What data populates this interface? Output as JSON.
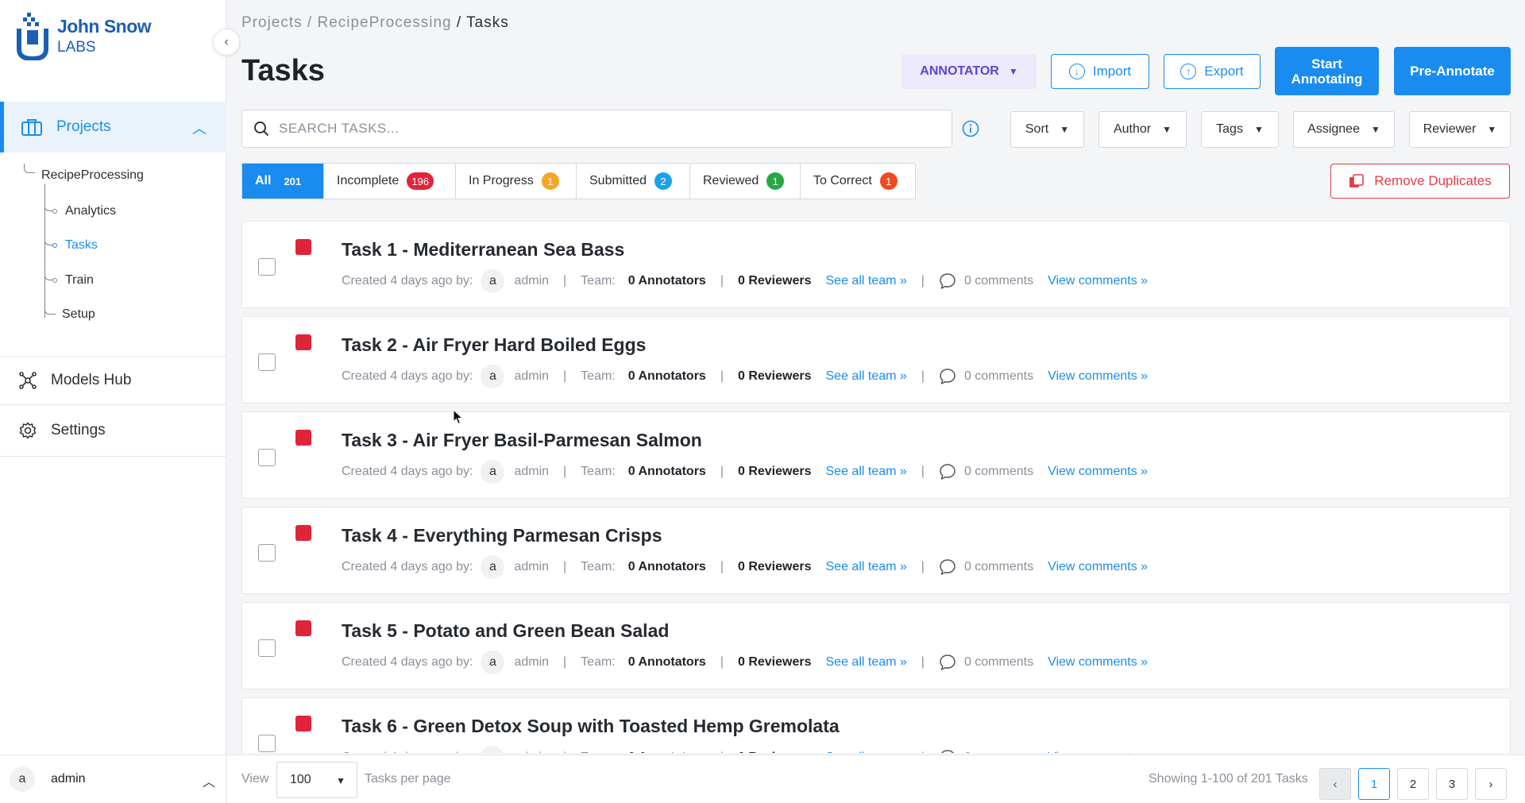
{
  "app": {
    "logo_line1": "John Snow",
    "logo_line2": "LABS"
  },
  "sidebar": {
    "projects_label": "Projects",
    "project_name": "RecipeProcessing",
    "sub_items": [
      {
        "label": "Analytics"
      },
      {
        "label": "Tasks"
      },
      {
        "label": "Train"
      },
      {
        "label": "Setup"
      }
    ],
    "models_hub_label": "Models Hub",
    "settings_label": "Settings",
    "user_initial": "a",
    "user_name": "admin"
  },
  "breadcrumb": {
    "part1": "Projects",
    "part2": "RecipeProcessing",
    "current": "Tasks"
  },
  "page_title": "Tasks",
  "toolbar": {
    "role": "ANNOTATOR",
    "import_label": "Import",
    "export_label": "Export",
    "start_line1": "Start",
    "start_line2": "Annotating",
    "preannotate_label": "Pre-Annotate"
  },
  "search": {
    "placeholder": "SEARCH TASKS...",
    "value": ""
  },
  "filters": {
    "sort": "Sort",
    "author": "Author",
    "tags": "Tags",
    "assignee": "Assignee",
    "reviewer": "Reviewer"
  },
  "status_tabs": [
    {
      "label": "All",
      "count": "201",
      "color": "#1a8cf0"
    },
    {
      "label": "Incomplete",
      "count": "196",
      "color": "#e0243a"
    },
    {
      "label": "In Progress",
      "count": "1",
      "color": "#f5a623"
    },
    {
      "label": "Submitted",
      "count": "2",
      "color": "#1aa3e8"
    },
    {
      "label": "Reviewed",
      "count": "1",
      "color": "#27a844"
    },
    {
      "label": "To Correct",
      "count": "1",
      "color": "#f04a1e"
    }
  ],
  "remove_duplicates_label": "Remove Duplicates",
  "task_meta": {
    "created": "Created 4 days ago by:",
    "author_initial": "a",
    "author": "admin",
    "team": "Team:",
    "annotators": "0 Annotators",
    "reviewers": "0 Reviewers",
    "see_all_team": "See all team »",
    "comments": "0 comments",
    "view_comments": "View comments »",
    "pipe": "|"
  },
  "tasks": [
    {
      "title": "Task 1 - Mediterranean Sea Bass"
    },
    {
      "title": "Task 2 - Air Fryer Hard Boiled Eggs"
    },
    {
      "title": "Task 3 - Air Fryer Basil-Parmesan Salmon"
    },
    {
      "title": "Task 4 - Everything Parmesan Crisps"
    },
    {
      "title": "Task 5 - Potato and Green Bean Salad"
    },
    {
      "title": "Task 6 - Green Detox Soup with Toasted Hemp Gremolata"
    }
  ],
  "pagination": {
    "view_label": "View",
    "per_page": "100",
    "per_page_label": "Tasks per page",
    "showing": "Showing 1-100 of 201 Tasks",
    "pages": [
      "1",
      "2",
      "3"
    ],
    "prev": "‹",
    "next": "›"
  },
  "colors": {
    "accent": "#1a8cf0",
    "danger": "#e23d4a",
    "role_bg": "#ece9fb",
    "role_text": "#5b45cf",
    "task_flag": "#e0243a"
  }
}
